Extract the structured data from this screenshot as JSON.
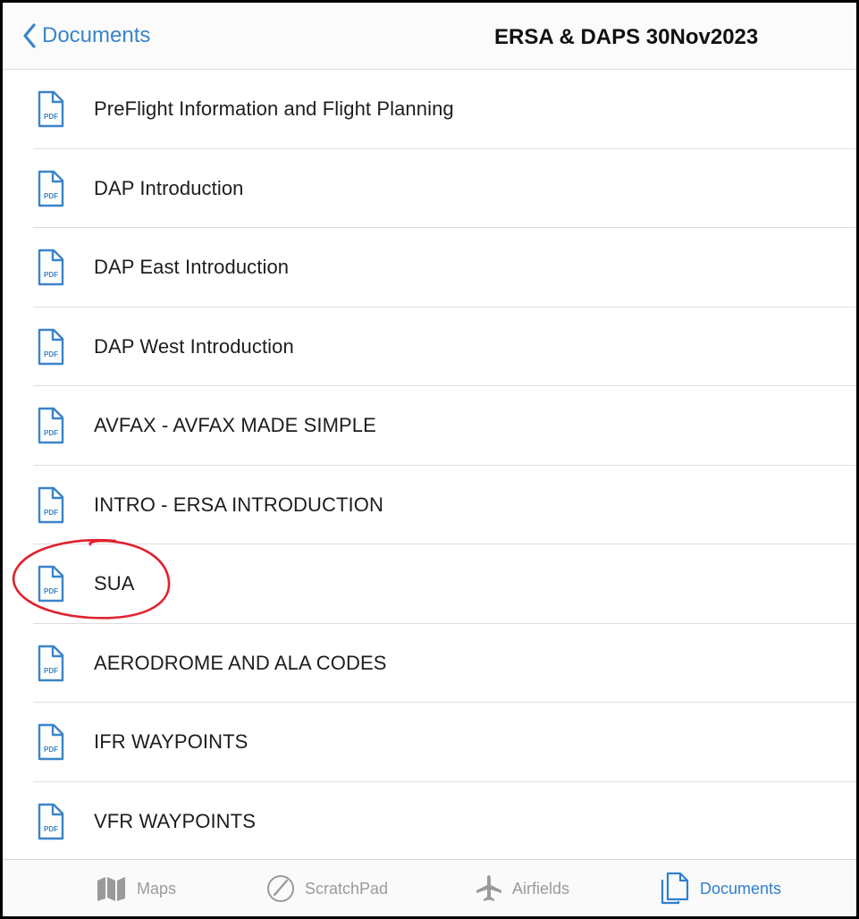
{
  "navbar": {
    "back_label": "Documents",
    "title": "ERSA & DAPS 30Nov2023"
  },
  "documents": [
    {
      "label": "PreFlight Information and Flight Planning",
      "icon": "pdf-icon"
    },
    {
      "label": "DAP Introduction",
      "icon": "pdf-icon"
    },
    {
      "label": "DAP East Introduction",
      "icon": "pdf-icon"
    },
    {
      "label": "DAP West Introduction",
      "icon": "pdf-icon"
    },
    {
      "label": "AVFAX - AVFAX MADE SIMPLE",
      "icon": "pdf-icon"
    },
    {
      "label": "INTRO - ERSA INTRODUCTION",
      "icon": "pdf-icon"
    },
    {
      "label": "SUA",
      "icon": "pdf-icon"
    },
    {
      "label": "AERODROME AND ALA CODES",
      "icon": "pdf-icon"
    },
    {
      "label": "IFR WAYPOINTS",
      "icon": "pdf-icon"
    },
    {
      "label": "VFR WAYPOINTS",
      "icon": "pdf-icon"
    }
  ],
  "pdf_badge_text": "PDF",
  "tabbar": {
    "tabs": [
      {
        "label": "Maps",
        "icon": "map-icon",
        "active": false
      },
      {
        "label": "ScratchPad",
        "icon": "scratchpad-icon",
        "active": false
      },
      {
        "label": "Airfields",
        "icon": "airplane-icon",
        "active": false
      },
      {
        "label": "Documents",
        "icon": "documents-icon",
        "active": true
      }
    ]
  },
  "colors": {
    "accent": "#2f7fd0",
    "inactive_tab": "#9a9a9a",
    "annotation": "#e0222e"
  }
}
